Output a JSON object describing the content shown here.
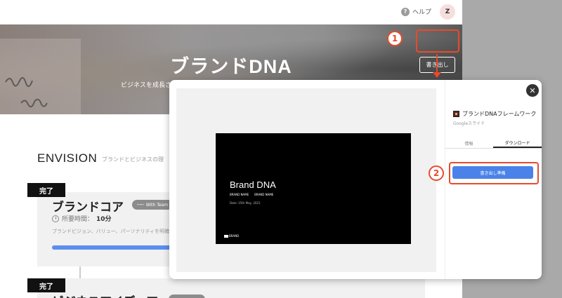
{
  "topbar": {
    "help_label": "ヘルプ",
    "help_icon": "?",
    "avatar_initial": "Z"
  },
  "hero": {
    "title": "ブランドDNA",
    "subtitle": "ビジネスを成長さ",
    "export_label": "書き出し"
  },
  "section": {
    "title": "ENVISION",
    "subtitle": "ブランドとビジネスの理"
  },
  "cards": [
    {
      "badge": "完了",
      "title": "ブランドコア",
      "tag": "With Team",
      "time_label": "所要時間：",
      "time_value": "10分",
      "description": "ブランドビジョン、バリュー、パーソナリティを明確に",
      "progress": 1.0
    },
    {
      "badge": "完了",
      "title": "ビジネスアイディア"
    }
  ],
  "modal": {
    "close_icon": "✕",
    "file_name": "ブランドDNAフレームワーク",
    "file_type": "Googleスライド",
    "tabs": [
      {
        "label": "情報",
        "active": false
      },
      {
        "label": "ダウンロード",
        "active": true
      }
    ],
    "prepare_label": "書き出し準備",
    "slide": {
      "title": "Brand DNA",
      "brand1": "BRAND NAME",
      "brand2": "BRAND NAME",
      "date": "Date:    25th May, 2021",
      "logo_text": "BRAND"
    }
  },
  "annotations": {
    "step1": "1",
    "step2": "2"
  },
  "colors": {
    "accent": "#4a82ea",
    "annotation": "#e84b2c",
    "progress": "#5b8ef0"
  }
}
